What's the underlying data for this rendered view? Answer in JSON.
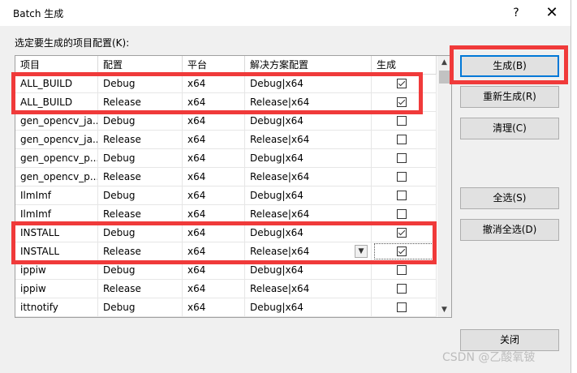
{
  "window": {
    "title": "Batch 生成",
    "help": "?",
    "close": "✕"
  },
  "prompt": "选定要生成的项目配置(K):",
  "columns": [
    "项目",
    "配置",
    "平台",
    "解决方案配置",
    "生成"
  ],
  "rows": [
    {
      "project": "ALL_BUILD",
      "config": "Debug",
      "platform": "x64",
      "solution": "Debug|x64",
      "build": true
    },
    {
      "project": "ALL_BUILD",
      "config": "Release",
      "platform": "x64",
      "solution": "Release|x64",
      "build": true
    },
    {
      "project": "gen_opencv_ja...",
      "config": "Debug",
      "platform": "x64",
      "solution": "Debug|x64",
      "build": false
    },
    {
      "project": "gen_opencv_ja...",
      "config": "Release",
      "platform": "x64",
      "solution": "Release|x64",
      "build": false
    },
    {
      "project": "gen_opencv_p...",
      "config": "Debug",
      "platform": "x64",
      "solution": "Debug|x64",
      "build": false
    },
    {
      "project": "gen_opencv_p...",
      "config": "Release",
      "platform": "x64",
      "solution": "Release|x64",
      "build": false
    },
    {
      "project": "IlmImf",
      "config": "Debug",
      "platform": "x64",
      "solution": "Debug|x64",
      "build": false
    },
    {
      "project": "IlmImf",
      "config": "Release",
      "platform": "x64",
      "solution": "Release|x64",
      "build": false
    },
    {
      "project": "INSTALL",
      "config": "Debug",
      "platform": "x64",
      "solution": "Debug|x64",
      "build": true
    },
    {
      "project": "INSTALL",
      "config": "Release",
      "platform": "x64",
      "solution": "Release|x64",
      "build": true
    },
    {
      "project": "ippiw",
      "config": "Debug",
      "platform": "x64",
      "solution": "Debug|x64",
      "build": false
    },
    {
      "project": "ippiw",
      "config": "Release",
      "platform": "x64",
      "solution": "Release|x64",
      "build": false
    },
    {
      "project": "ittnotify",
      "config": "Debug",
      "platform": "x64",
      "solution": "Debug|x64",
      "build": false
    }
  ],
  "buttons": {
    "build": "生成(B)",
    "rebuild": "重新生成(R)",
    "clean": "清理(C)",
    "select_all": "全选(S)",
    "deselect_all": "撤消全选(D)",
    "close": "关闭"
  },
  "watermark": "CSDN @乙酸氧铍",
  "colors": {
    "highlight": "#f03a3a",
    "default_button_border": "#0078d7"
  }
}
